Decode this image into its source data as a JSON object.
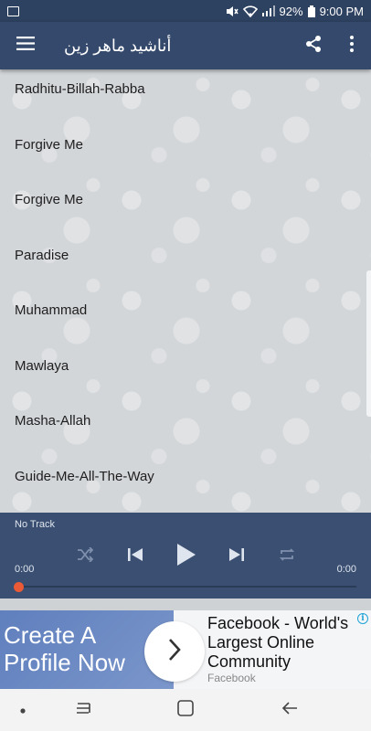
{
  "status_bar": {
    "battery": "92%",
    "time": "9:00 PM"
  },
  "app_bar": {
    "title": "أناشيد ماهر زين"
  },
  "tracks": [
    "Radhitu-Billah-Rabba",
    "Forgive Me",
    "Forgive Me",
    "Paradise",
    "Muhammad",
    "Mawlaya",
    "Masha-Allah",
    "Guide-Me-All-The-Way"
  ],
  "player": {
    "track": "No Track",
    "time_elapsed": "0:00",
    "time_total": "0:00",
    "progress": 0
  },
  "ad": {
    "headline": "Create A Profile Now",
    "copy": "Facebook - World's Largest Online Community",
    "source": "Facebook",
    "info": "i"
  },
  "colors": {
    "status_bar": "#2d4160",
    "app_bar": "#34496b",
    "player": "#3a4f71",
    "seek_accent": "#ea5a36",
    "ad_blue": "#6d8cc2"
  },
  "icons": {
    "status": [
      "gallery-icon",
      "mute-icon",
      "wifi-icon",
      "signal-icon",
      "battery-icon"
    ],
    "app_bar": [
      "menu-icon",
      "share-icon",
      "more-vert-icon"
    ],
    "player": [
      "shuffle-icon",
      "previous-icon",
      "play-icon",
      "next-icon",
      "repeat-icon"
    ],
    "nav": [
      "dot-icon",
      "recent-apps-icon",
      "home-icon",
      "back-icon"
    ]
  }
}
